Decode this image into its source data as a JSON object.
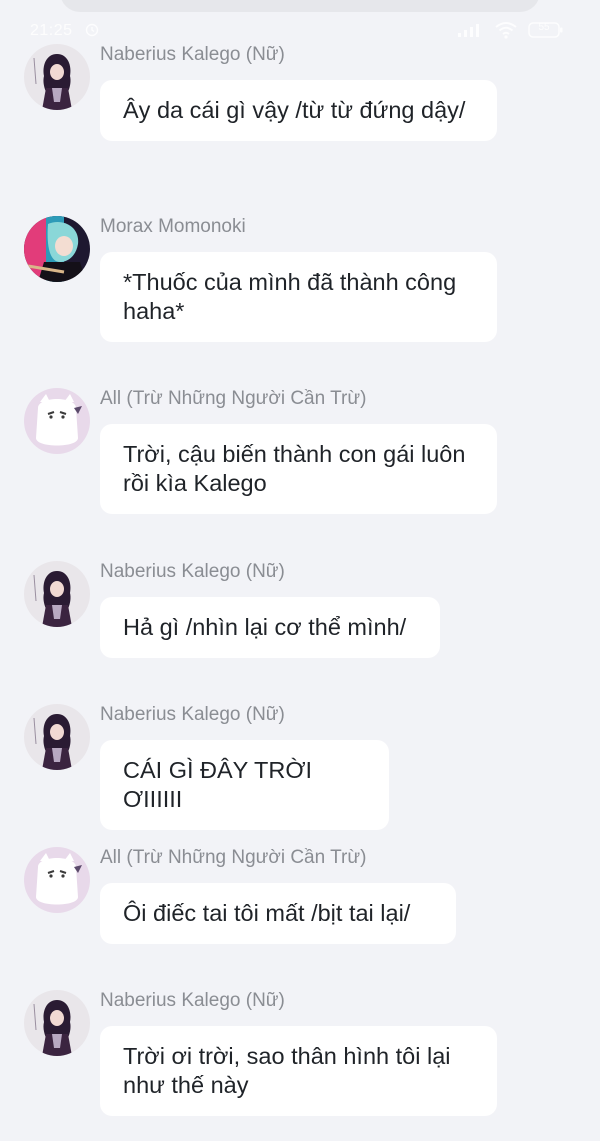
{
  "status_bar": {
    "time": "21:25",
    "alarm_icon": "alarm-clock-icon",
    "signal_icon": "signal-bars-icon",
    "wifi_icon": "wifi-icon",
    "battery_icon": "battery-icon",
    "battery_level": "55"
  },
  "colors": {
    "background": "#f2f3f7",
    "bubble": "#ffffff",
    "sender_text": "#8a8d93",
    "message_text": "#1f2328"
  },
  "messages": [
    {
      "sender": "Naberius Kalego (Nữ)",
      "avatar_icon": "kalego-avatar-icon",
      "text": "Ây da cái gì vậy /từ từ đứng dậy/"
    },
    {
      "sender": "Morax Momonoki",
      "avatar_icon": "momonoki-avatar-icon",
      "text": "*Thuốc của mình đã thành công haha*"
    },
    {
      "sender": "All (Trừ Những Người Cần Trừ)",
      "avatar_icon": "ghost-avatar-icon",
      "text": "Trời, cậu biến thành con gái luôn rồi kìa Kalego"
    },
    {
      "sender": "Naberius Kalego (Nữ)",
      "avatar_icon": "kalego-avatar-icon",
      "text": "Hả gì /nhìn lại cơ thể mình/"
    },
    {
      "sender": "Naberius Kalego (Nữ)",
      "avatar_icon": "kalego-avatar-icon",
      "text": "CÁI GÌ ĐÂY TRỜI ƠIIIIII"
    },
    {
      "sender": "All (Trừ Những Người Cần Trừ)",
      "avatar_icon": "ghost-avatar-icon",
      "text": "Ôi điếc tai tôi mất /bịt tai lại/"
    },
    {
      "sender": "Naberius Kalego (Nữ)",
      "avatar_icon": "kalego-avatar-icon",
      "text": "Trời ơi trời, sao thân hình tôi lại như thế này"
    }
  ]
}
